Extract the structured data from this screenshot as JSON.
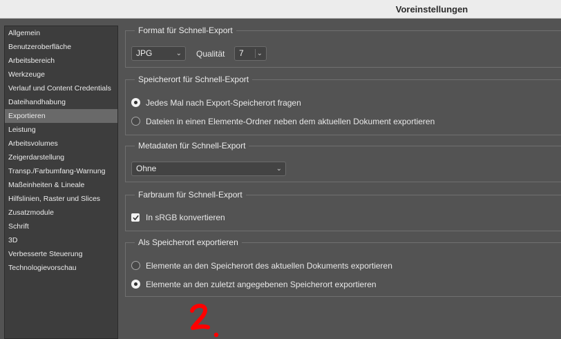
{
  "window": {
    "title": "Voreinstellungen"
  },
  "sidebar": {
    "items": [
      {
        "label": "Allgemein",
        "selected": false
      },
      {
        "label": "Benutzeroberfläche",
        "selected": false
      },
      {
        "label": "Arbeitsbereich",
        "selected": false
      },
      {
        "label": "Werkzeuge",
        "selected": false
      },
      {
        "label": "Verlauf und Content Credentials",
        "selected": false
      },
      {
        "label": "Dateihandhabung",
        "selected": false
      },
      {
        "label": "Exportieren",
        "selected": true
      },
      {
        "label": "Leistung",
        "selected": false
      },
      {
        "label": "Arbeitsvolumes",
        "selected": false
      },
      {
        "label": "Zeigerdarstellung",
        "selected": false
      },
      {
        "label": "Transp./Farbumfang-Warnung",
        "selected": false
      },
      {
        "label": "Maßeinheiten & Lineale",
        "selected": false
      },
      {
        "label": "Hilfslinien, Raster und Slices",
        "selected": false
      },
      {
        "label": "Zusatzmodule",
        "selected": false
      },
      {
        "label": "Schrift",
        "selected": false
      },
      {
        "label": "3D",
        "selected": false
      },
      {
        "label": "Verbesserte Steuerung",
        "selected": false
      },
      {
        "label": "Technologievorschau",
        "selected": false
      }
    ]
  },
  "format": {
    "title": "Format für Schnell-Export",
    "format_value": "JPG",
    "quality_label": "Qualität",
    "quality_value": "7"
  },
  "location": {
    "title": "Speicherort für Schnell-Export",
    "options": [
      {
        "label": "Jedes Mal nach Export-Speicherort fragen",
        "checked": true
      },
      {
        "label": "Dateien in einen Elemente-Ordner neben dem aktuellen Dokument exportieren",
        "checked": false
      }
    ]
  },
  "metadata": {
    "title": "Metadaten für Schnell-Export",
    "value": "Ohne"
  },
  "colorspace": {
    "title": "Farbraum für Schnell-Export",
    "checkbox_label": "In sRGB konvertieren",
    "checked": true
  },
  "export_as": {
    "title": "Als Speicherort exportieren",
    "options": [
      {
        "label": "Elemente an den Speicherort des aktuellen Dokuments exportieren",
        "checked": false
      },
      {
        "label": "Elemente an den zuletzt angegebenen Speicherort exportieren",
        "checked": true
      }
    ]
  },
  "annotation": {
    "text": "2.",
    "color": "#ff0000"
  },
  "colors": {
    "selection": "#696969",
    "panel": "#535353",
    "sidebar": "#3d3d3d"
  }
}
